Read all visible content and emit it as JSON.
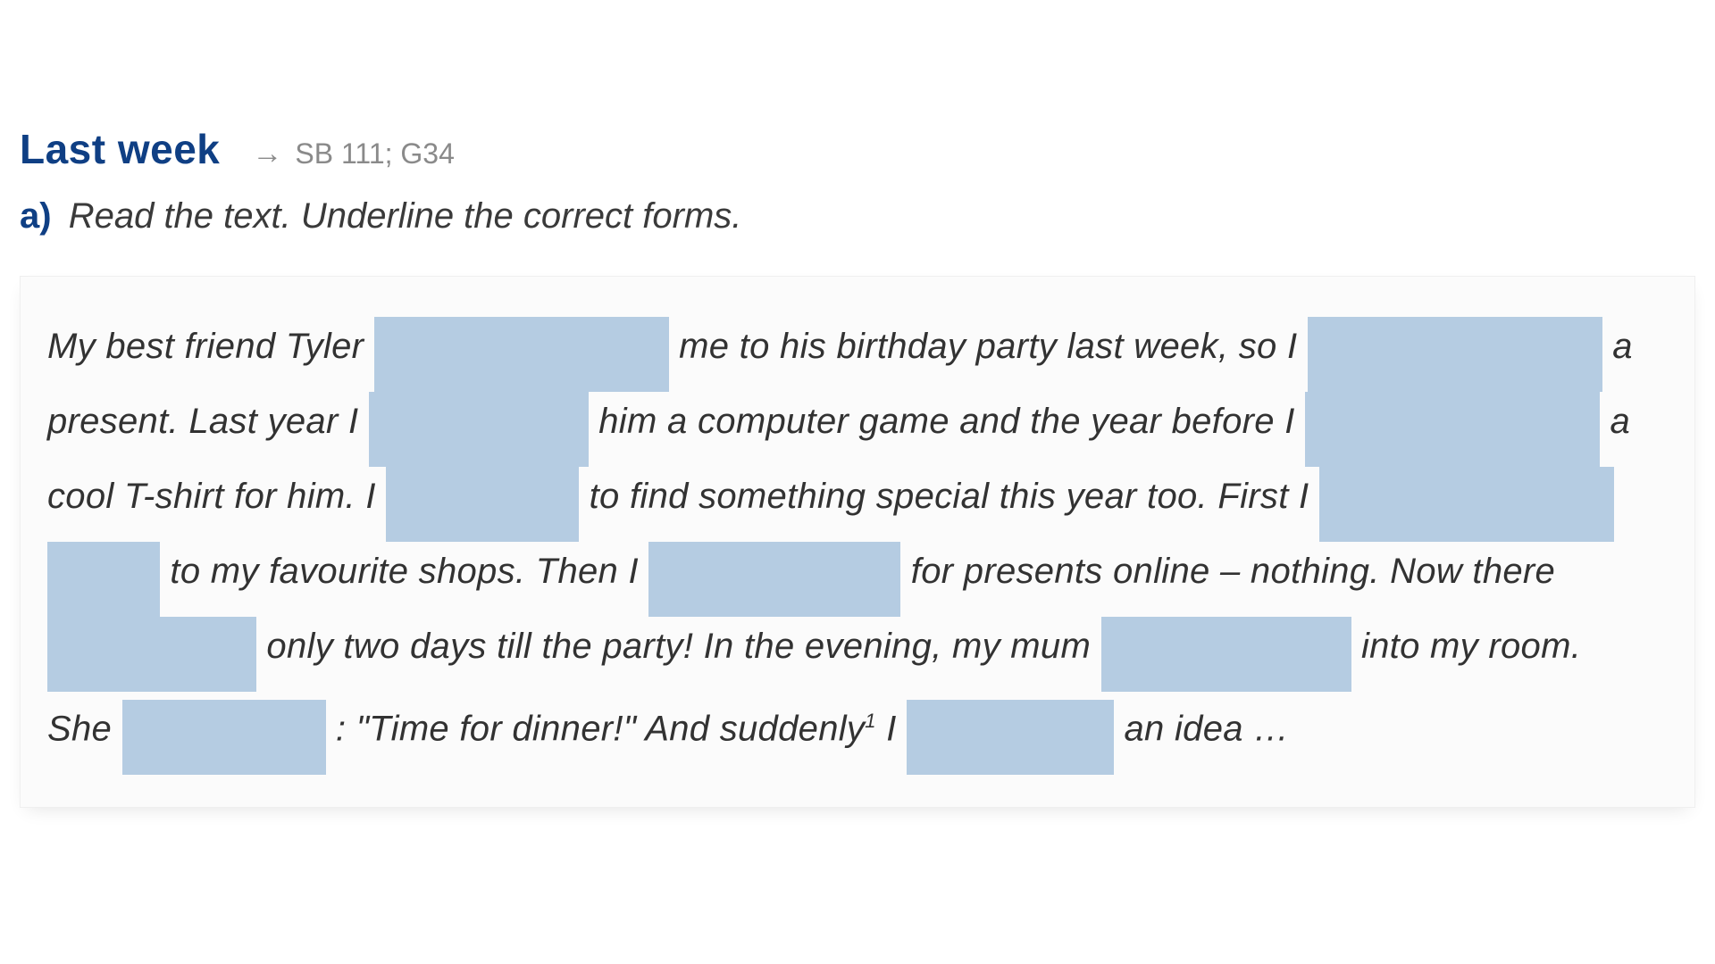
{
  "header": {
    "title": "Last week",
    "arrow": "→",
    "reference": "SB 111; G34"
  },
  "task": {
    "label": "a)",
    "instruction": "Read the text. Underline the correct forms."
  },
  "body": {
    "seg1": "My best friend Tyler",
    "seg2": "me to his birthday party last week, so I",
    "seg3": "a present. Last year I",
    "seg4": "him a computer game and the year before I",
    "seg5": "a cool T-shirt for him. I",
    "seg6": "to find something special this year too. First I",
    "seg7": "to my favourite shops. Then I",
    "seg8": "for presents online – nothing. Now there",
    "seg9": "only two days till the party! In the evening, my mum",
    "seg10": "into my room.",
    "seg11": "She",
    "seg12": ": \"Time for dinner!\"  And suddenly",
    "seg12_sup": "1",
    "seg12b": " I",
    "seg13": "an idea …"
  }
}
